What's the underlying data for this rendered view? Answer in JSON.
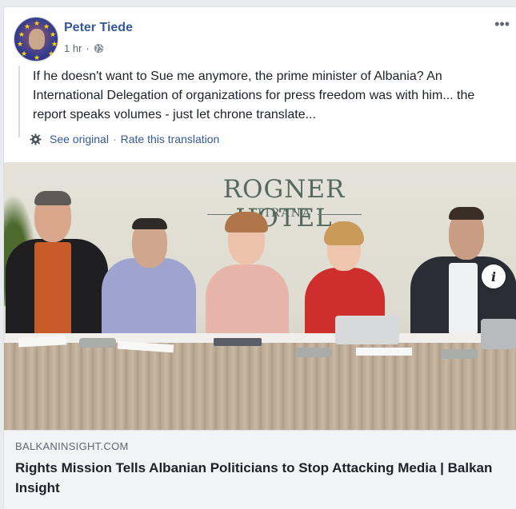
{
  "post": {
    "author": "Peter Tiede",
    "time": "1 hr",
    "dot": "·",
    "privacy_icon": "globe-icon",
    "more_icon": "more-options-icon",
    "more_glyph": "•••",
    "text": "If he doesn't want to Sue me anymore, the prime minister of Albania? An International Delegation of organizations for press freedom was with him... the report speaks volumes - just let chrone translate..."
  },
  "translation": {
    "see_original": "See original",
    "separator": "·",
    "rate": "Rate this translation"
  },
  "photo": {
    "sign_name": "ROGNER HOTEL",
    "sign_city": "TIRANA",
    "info_glyph": "i"
  },
  "link": {
    "domain": "BALKANINSIGHT.COM",
    "title": "Rights Mission Tells Albanian Politicians to Stop Attacking Media | Balkan Insight"
  },
  "colors": {
    "link_blue": "#365899",
    "text": "#1d2129",
    "meta": "#616770",
    "link_box_bg": "#f2f3f5"
  }
}
